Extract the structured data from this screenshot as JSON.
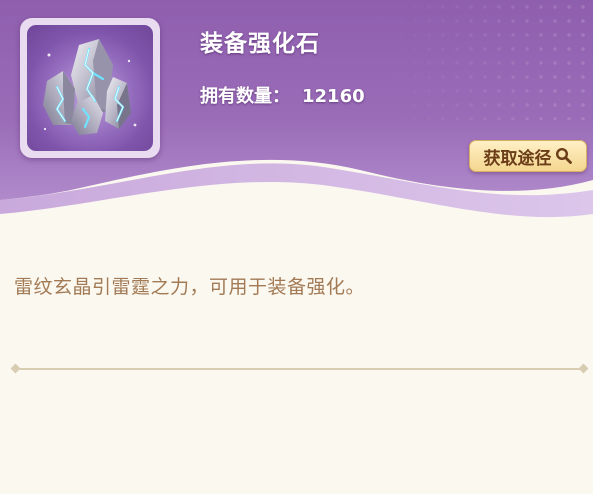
{
  "item": {
    "name": "装备强化石",
    "quantity_label": "拥有数量：",
    "quantity_value": "12160",
    "icon": "lightning-crystal-icon"
  },
  "actions": {
    "source_label": "获取途径",
    "source_icon": "search-icon"
  },
  "description": "雷纹玄晶引雷霆之力，可用于装备强化。",
  "colors": {
    "header_purple": "#9466b2",
    "body_cream": "#fbf8f0",
    "description_text": "#a27a55",
    "button_gold": "#f4d68f"
  }
}
